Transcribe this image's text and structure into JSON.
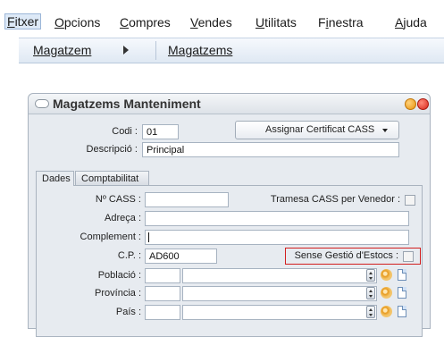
{
  "menu": {
    "items": [
      {
        "label": "Fitxer",
        "underline": "F",
        "rest": "itxer"
      },
      {
        "label": "Opcions",
        "underline": "O",
        "rest": "pcions"
      },
      {
        "label": "Compres",
        "underline": "C",
        "rest": "ompres"
      },
      {
        "label": "Vendes",
        "underline": "V",
        "rest": "endes"
      },
      {
        "label": "Utilitats",
        "underline": "U",
        "rest": "tilitats"
      },
      {
        "label": "Finestra",
        "pre": "F",
        "underline": "i",
        "rest": "nestra"
      },
      {
        "label": "Ajuda",
        "underline": "A",
        "rest": "juda"
      }
    ]
  },
  "submenu": {
    "parent": "Magatzem",
    "child": "Magatzems"
  },
  "window": {
    "title": "Magatzems Manteniment",
    "codi_label": "Codi :",
    "codi_value": "01",
    "descripcio_label": "Descripció :",
    "descripcio_value": "Principal",
    "cass_button": "Assignar Certificat CASS"
  },
  "tabs": {
    "dades": "Dades",
    "comptabilitat": "Comptabilitat"
  },
  "form": {
    "n_cass_label": "Nº CASS :",
    "n_cass_value": "",
    "tramesa_label": "Tramesa CASS per Venedor :",
    "adreca_label": "Adreça :",
    "adreca_value": "",
    "complement_label": "Complement :",
    "complement_value": "",
    "cp_label": "C.P. :",
    "cp_value": "AD600",
    "sense_gestio_label": "Sense Gestió d'Estocs :",
    "poblacio_label": "Població :",
    "provincia_label": "Província :",
    "pais_label": "País :"
  },
  "colors": {
    "highlight": "#d21f1f",
    "window_bg": "#e7ebf0",
    "menu_active_bg": "#dde9f7"
  },
  "icons": [
    "window-pill-icon",
    "minimize-icon",
    "close-icon",
    "dropdown-caret-icon",
    "stepper-icon",
    "sync-icon",
    "document-icon"
  ]
}
